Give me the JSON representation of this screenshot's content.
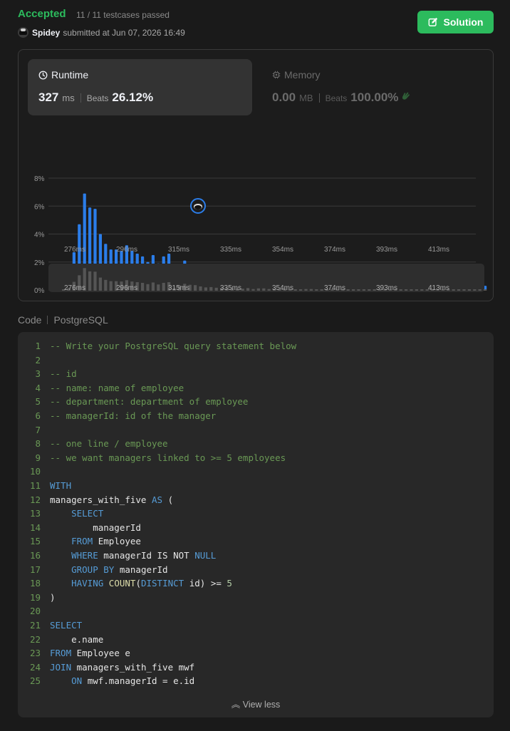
{
  "header": {
    "status": "Accepted",
    "testcases": "11 / 11 testcases passed",
    "username": "Spidey",
    "submitted_text": "submitted at Jun 07, 2026 16:49",
    "solution_label": "Solution"
  },
  "runtime": {
    "title": "Runtime",
    "value": "327",
    "unit": "ms",
    "beats_label": "Beats",
    "beats": "26.12%"
  },
  "memory": {
    "title": "Memory",
    "value": "0.00",
    "unit": "MB",
    "beats_label": "Beats",
    "beats": "100.00%"
  },
  "chart_data": {
    "type": "bar",
    "y_ticks": [
      "8%",
      "6%",
      "4%",
      "2%",
      "0%"
    ],
    "x_ticks": [
      "276ms",
      "296ms",
      "315ms",
      "335ms",
      "354ms",
      "374ms",
      "393ms",
      "413ms"
    ],
    "ylim": [
      0,
      8
    ],
    "values": [
      0.2,
      0.8,
      2.7,
      4.7,
      6.9,
      5.9,
      5.8,
      4.0,
      3.3,
      2.9,
      2.9,
      2.8,
      3.2,
      2.8,
      2.6,
      2.4,
      2.0,
      2.5,
      1.9,
      2.4,
      2.6,
      0.8,
      1.6,
      2.1,
      1.8,
      1.7,
      1.3,
      1.0,
      1.1,
      0.9,
      0.8,
      0.8,
      0.7,
      0.6,
      0.6,
      0.8,
      0.5,
      0.7,
      0.7,
      0.5,
      0.6,
      0.3,
      0.6,
      0.3,
      0.4,
      0.2,
      0.5,
      0.5,
      0.3,
      0.3,
      0.3,
      0.3,
      0.3,
      0.3,
      0.3,
      0.3,
      0.3,
      0.3,
      0.3,
      0.3,
      0.3,
      0.3,
      0.3,
      0.3,
      0.3,
      0.3,
      0.3,
      0.3,
      0.3,
      0.3,
      0.3,
      0.3,
      0.3,
      0.3,
      0.3,
      0.3,
      0.3,
      0.3,
      0.3,
      0.3,
      0.3
    ],
    "bar_color": "#2b7de9",
    "marker_index": 33
  },
  "code": {
    "label": "Code",
    "language": "PostgreSQL",
    "line_numbers": [
      "1",
      "2",
      "3",
      "4",
      "5",
      "6",
      "7",
      "8",
      "9",
      "10",
      "11",
      "12",
      "13",
      "14",
      "15",
      "16",
      "17",
      "18",
      "19",
      "20",
      "21",
      "22",
      "23",
      "24",
      "25"
    ],
    "lines": [
      [
        [
          "cm",
          "-- Write your PostgreSQL query statement below"
        ]
      ],
      [],
      [
        [
          "cm",
          "-- id"
        ]
      ],
      [
        [
          "cm",
          "-- name: name of employee"
        ]
      ],
      [
        [
          "cm",
          "-- department: department of employee"
        ]
      ],
      [
        [
          "cm",
          "-- managerId: id of the manager"
        ]
      ],
      [],
      [
        [
          "cm",
          "-- one line / employee"
        ]
      ],
      [
        [
          "cm",
          "-- we want managers linked to >= 5 employees"
        ]
      ],
      [],
      [
        [
          "kw",
          "WITH"
        ]
      ],
      [
        [
          "tx",
          "managers_with_five "
        ],
        [
          "kw",
          "AS"
        ],
        [
          "tx",
          " ("
        ]
      ],
      [
        [
          "tx",
          "    "
        ],
        [
          "kw",
          "SELECT"
        ]
      ],
      [
        [
          "tx",
          "        managerId"
        ]
      ],
      [
        [
          "tx",
          "    "
        ],
        [
          "kw",
          "FROM"
        ],
        [
          "tx",
          " Employee"
        ]
      ],
      [
        [
          "tx",
          "    "
        ],
        [
          "kw",
          "WHERE"
        ],
        [
          "tx",
          " managerId IS NOT "
        ],
        [
          "kw",
          "NULL"
        ]
      ],
      [
        [
          "tx",
          "    "
        ],
        [
          "kw",
          "GROUP BY"
        ],
        [
          "tx",
          " managerId"
        ]
      ],
      [
        [
          "tx",
          "    "
        ],
        [
          "kw",
          "HAVING"
        ],
        [
          "tx",
          " "
        ],
        [
          "fn",
          "COUNT"
        ],
        [
          "tx",
          "("
        ],
        [
          "kw",
          "DISTINCT"
        ],
        [
          "tx",
          " id) >= "
        ],
        [
          "nm",
          "5"
        ]
      ],
      [
        [
          "tx",
          ")"
        ]
      ],
      [],
      [
        [
          "kw",
          "SELECT"
        ]
      ],
      [
        [
          "tx",
          "    e.name"
        ]
      ],
      [
        [
          "kw",
          "FROM"
        ],
        [
          "tx",
          " Employee e"
        ]
      ],
      [
        [
          "kw",
          "JOIN"
        ],
        [
          "tx",
          " managers_with_five mwf"
        ]
      ],
      [
        [
          "tx",
          "    "
        ],
        [
          "kw",
          "ON"
        ],
        [
          "tx",
          " mwf.managerId = e.id"
        ]
      ]
    ],
    "view_less": "View less"
  }
}
